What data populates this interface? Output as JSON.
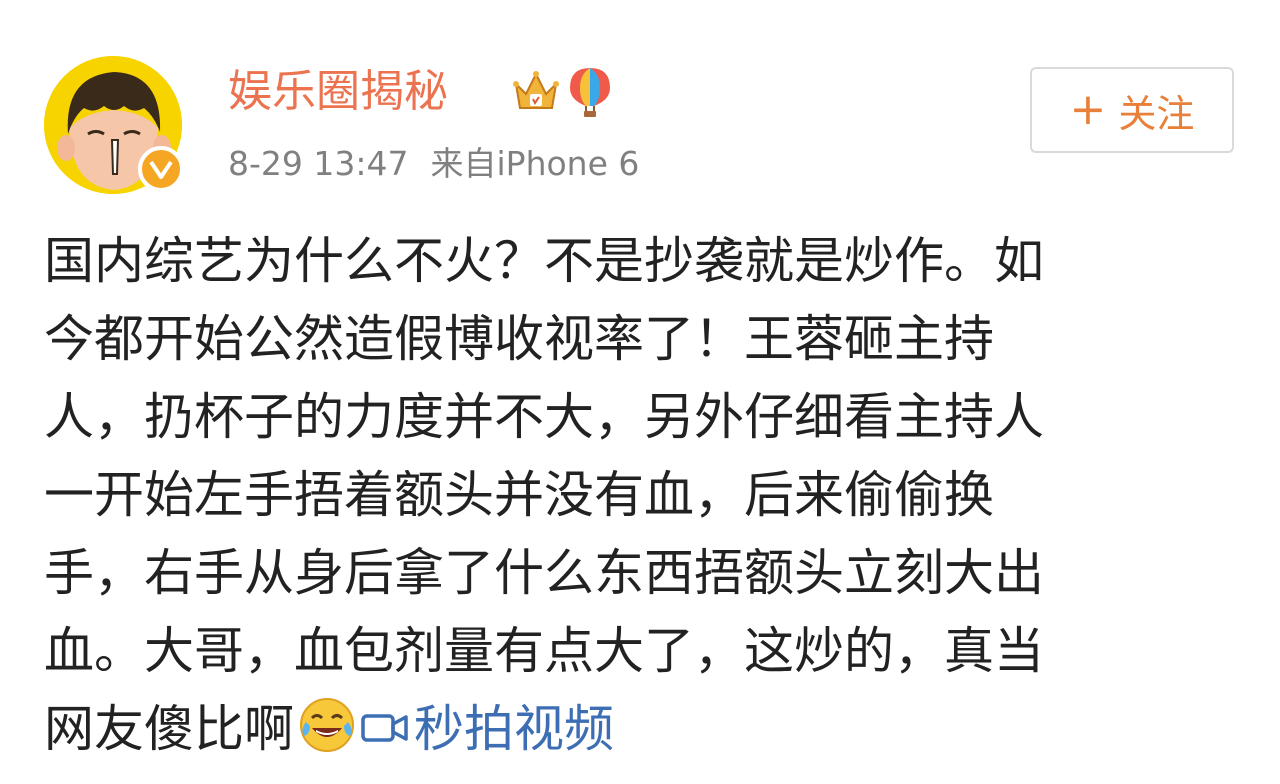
{
  "post": {
    "author_name": "娱乐圈揭秘",
    "timestamp": "8-29 13:47",
    "source": "来自iPhone 6",
    "follow_button": {
      "plus": "+",
      "label": "关注"
    },
    "content_lines": [
      "国内综艺为什么不火？不是抄袭就是炒作。如",
      "今都开始公然造假博收视率了！王蓉砸主持",
      "人，扔杯子的力度并不大，另外仔细看主持人",
      "一开始左手捂着额头并没有血，后来偷偷换",
      "手，右手从身后拿了什么东西捂额头立刻大出",
      "血。大哥，血包剂量有点大了，这炒的，真当"
    ],
    "content_last_line": "网友傻比啊",
    "video_link_label": "秒拍视频",
    "icons": {
      "avatar": "cartoon-boy-avatar",
      "verified": "verified-badge-icon",
      "crown": "vip-crown-icon",
      "balloon": "hot-air-balloon-icon",
      "emoji": "laughing-crying-emoji",
      "video": "video-camera-icon"
    },
    "colors": {
      "author_name": "#eb7350",
      "meta_text": "#808080",
      "follow_text": "#e8803a",
      "link": "#3d6eb4",
      "body_text": "#222222"
    }
  }
}
